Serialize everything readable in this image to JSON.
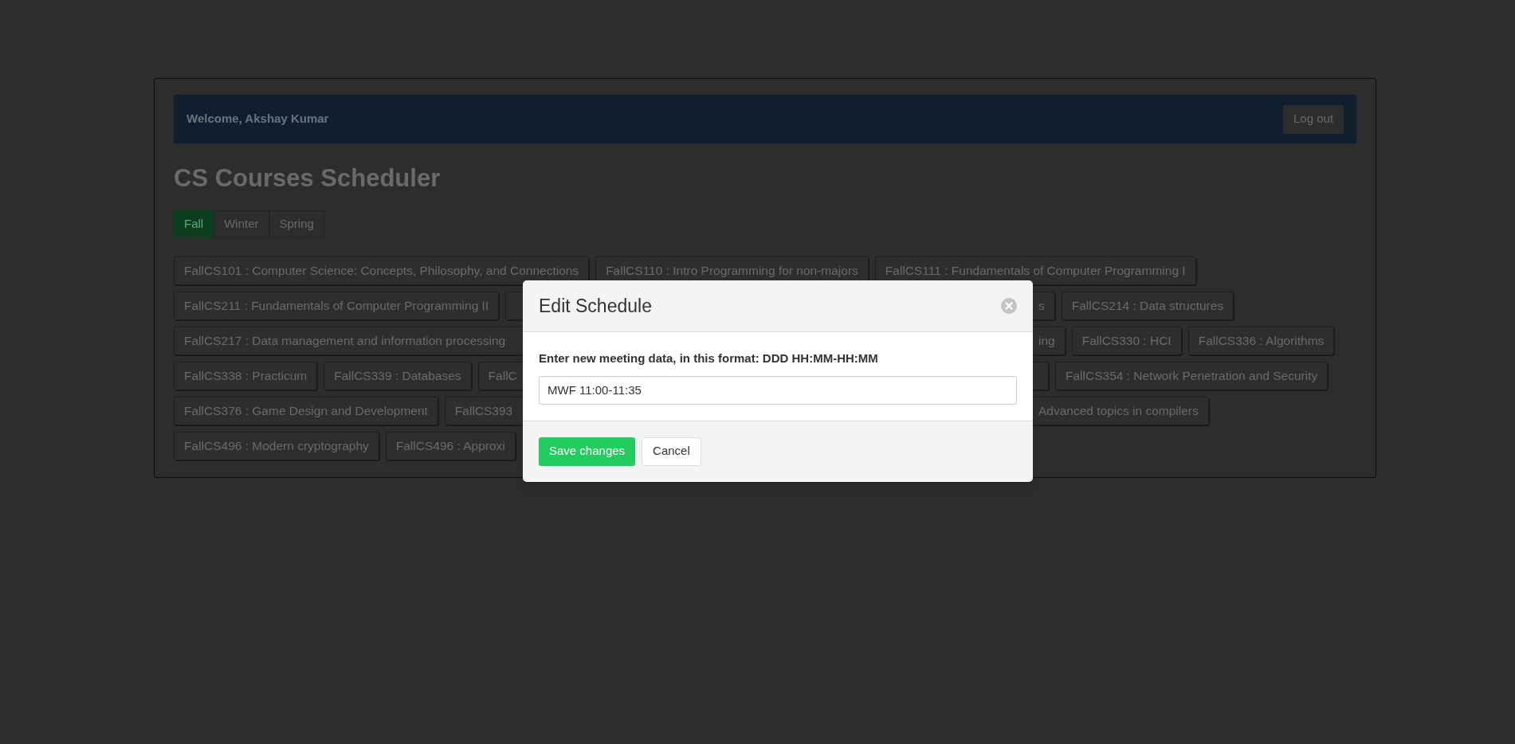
{
  "header": {
    "welcome": "Welcome, Akshay Kumar",
    "logout": "Log out"
  },
  "title": "CS Courses Scheduler",
  "tabs": [
    {
      "label": "Fall",
      "selected": true
    },
    {
      "label": "Winter",
      "selected": false
    },
    {
      "label": "Spring",
      "selected": false
    }
  ],
  "course_rows": [
    {
      "left": [
        {
          "kind": "full",
          "text": "FallCS101 : Computer Science: Concepts, Philosophy, and Connections"
        },
        {
          "kind": "full",
          "text": "FallCS110 : Intro Programming for non-majors"
        },
        {
          "kind": "full",
          "text": "FallCS111 : Fundamentals of Computer Programming I"
        }
      ]
    },
    {
      "left": [
        {
          "kind": "full",
          "text": "FallCS211 : Fundamentals of Computer Programming II"
        },
        {
          "kind": "cut_right"
        }
      ],
      "right": [
        {
          "kind": "cut_left",
          "text": "s"
        },
        {
          "kind": "full",
          "text": "FallCS214 : Data structures"
        }
      ]
    },
    {
      "left": [
        {
          "kind": "cut_right",
          "text": "FallCS217 : Data management and information processing"
        }
      ],
      "right": [
        {
          "kind": "cut_left",
          "text": "ing"
        },
        {
          "kind": "full",
          "text": "FallCS330 : HCI"
        },
        {
          "kind": "full",
          "text": "FallCS336 : Algorithms"
        }
      ]
    },
    {
      "left": [
        {
          "kind": "full",
          "text": "FallCS338 : Practicum"
        },
        {
          "kind": "full",
          "text": "FallCS339 : Databases"
        },
        {
          "kind": "cut_right",
          "text": "FallC"
        }
      ],
      "right": [
        {
          "kind": "cut_left"
        },
        {
          "kind": "full",
          "text": "FallCS354 : Network Penetration and Security"
        }
      ]
    },
    {
      "left": [
        {
          "kind": "full",
          "text": "FallCS376 : Game Design and Development"
        },
        {
          "kind": "cut_right",
          "text": "FallCS393"
        }
      ],
      "right": [
        {
          "kind": "cut_left",
          "text": "Advanced topics in compilers"
        }
      ]
    },
    {
      "left": [
        {
          "kind": "full",
          "text": "FallCS496 : Modern cryptography"
        },
        {
          "kind": "cut_right",
          "text": "FallCS496 : Approxi"
        }
      ]
    }
  ],
  "modal": {
    "title": "Edit Schedule",
    "label": "Enter new meeting data, in this format: DDD HH:MM-HH:MM",
    "value": "MWF 11:00-11:35",
    "save": "Save changes",
    "cancel": "Cancel"
  }
}
